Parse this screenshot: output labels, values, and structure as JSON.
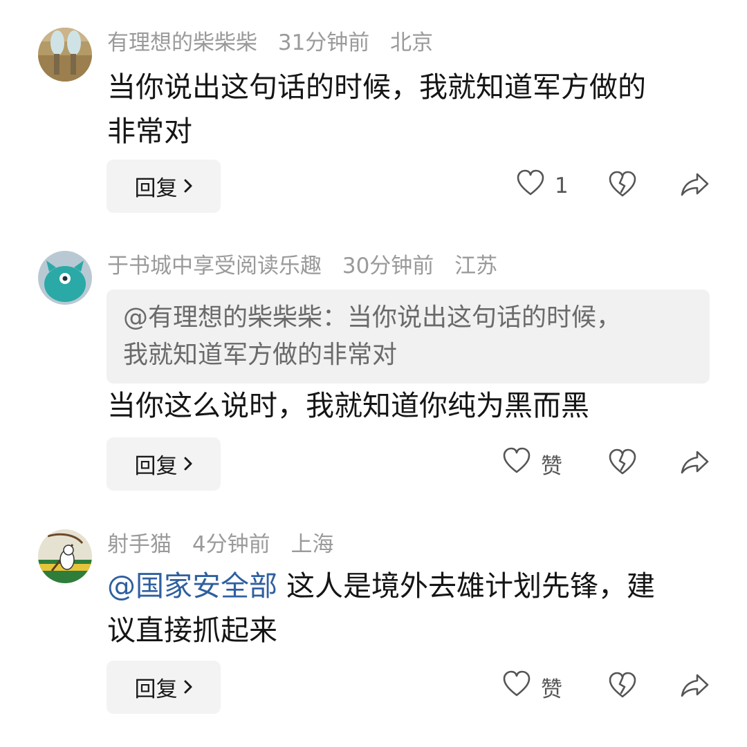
{
  "comments": [
    {
      "username": "有理想的柴柴柴",
      "time": "31分钟前",
      "location": "北京",
      "text_line1": "当你说出这句话的时候，我就知道军方做的",
      "text_line2": "非常对",
      "reply_label": "回复",
      "like_label": "1",
      "avatar_icon": "sneakers-photo-avatar"
    },
    {
      "username": "于书城中享受阅读乐趣",
      "time": "30分钟前",
      "location": "江苏",
      "quote_line1": "@有理想的柴柴柴：当你说出这句话的时候，",
      "quote_line2": "我就知道军方做的非常对",
      "text_line1": "当你这么说时，我就知道你纯为黑而黑",
      "reply_label": "回复",
      "like_label": "赞",
      "avatar_icon": "teal-cartoon-avatar"
    },
    {
      "username": "射手猫",
      "time": "4分钟前",
      "location": "上海",
      "mention": "@国家安全部",
      "text_line1_rest": " 这人是境外去雄计划先锋，建",
      "text_line2": "议直接抓起来",
      "reply_label": "回复",
      "like_label": "赞",
      "avatar_icon": "archer-cat-avatar"
    }
  ],
  "icons": {
    "like": "heart-outline-icon",
    "dislike": "broken-heart-icon",
    "share": "share-arrow-icon",
    "chevron": "chevron-right-icon"
  },
  "colors": {
    "meta_text": "#9a9a9a",
    "mention": "#2f5f9f",
    "quote_bg": "#f1f1f2",
    "button_bg": "#f3f3f3"
  }
}
